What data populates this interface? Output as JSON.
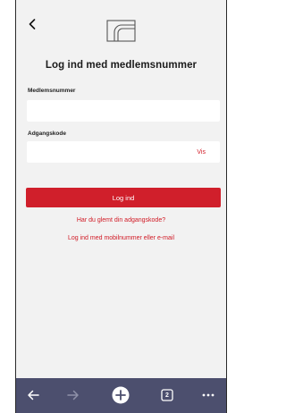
{
  "header": {
    "back_icon": "chevron-left-icon",
    "logo_icon": "card-logo-icon"
  },
  "form": {
    "title": "Log ind med medlemsnummer",
    "member_label": "Medlemsnummer",
    "member_value": "",
    "password_label": "Adgangskode",
    "password_value": "",
    "show_password": "Vis",
    "submit": "Log ind",
    "forgot_link": "Har du glemt din adgangskode?",
    "alt_login_link": "Log ind med mobilnummer eller e-mail"
  },
  "browser_bar": {
    "tab_count": "2",
    "icons": [
      "arrow-left-icon",
      "arrow-right-icon",
      "plus-circle-icon",
      "tabs-icon",
      "more-icon"
    ]
  },
  "colors": {
    "accent": "#d01f2b",
    "link": "#d11a25",
    "background": "#f2f2f2",
    "bottom_bar": "#4c4f6e"
  }
}
